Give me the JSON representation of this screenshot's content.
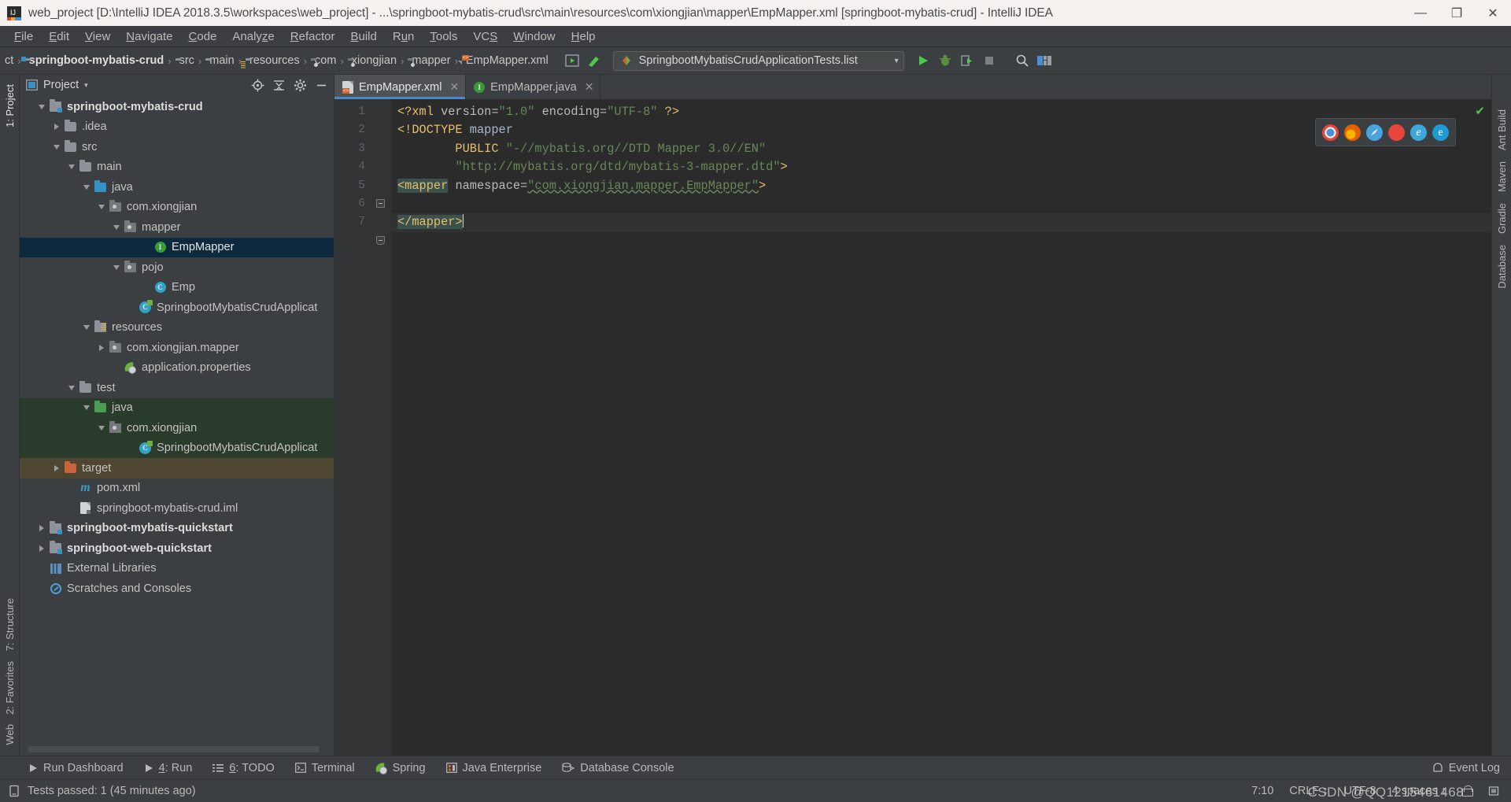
{
  "window": {
    "title": "web_project [D:\\IntelliJ IDEA 2018.3.5\\workspaces\\web_project] - ...\\springboot-mybatis-crud\\src\\main\\resources\\com\\xiongjian\\mapper\\EmpMapper.xml [springboot-mybatis-crud] - IntelliJ IDEA",
    "minimize": "—",
    "maximize": "❐",
    "close": "✕"
  },
  "menu": [
    {
      "label": "File",
      "accel": "F"
    },
    {
      "label": "Edit",
      "accel": "E"
    },
    {
      "label": "View",
      "accel": "V"
    },
    {
      "label": "Navigate",
      "accel": "N"
    },
    {
      "label": "Code",
      "accel": "C"
    },
    {
      "label": "Analyze",
      "accel": "z"
    },
    {
      "label": "Refactor",
      "accel": "R"
    },
    {
      "label": "Build",
      "accel": "B"
    },
    {
      "label": "Run",
      "accel": "u"
    },
    {
      "label": "Tools",
      "accel": "T"
    },
    {
      "label": "VCS",
      "accel": "S"
    },
    {
      "label": "Window",
      "accel": "W"
    },
    {
      "label": "Help",
      "accel": "H"
    }
  ],
  "breadcrumb": {
    "truncated": "ct",
    "items": [
      {
        "label": "springboot-mybatis-crud",
        "icon": "module-icon",
        "bold": true
      },
      {
        "label": "src",
        "icon": "folder-icon",
        "bold": false
      },
      {
        "label": "main",
        "icon": "folder-icon",
        "bold": false
      },
      {
        "label": "resources",
        "icon": "resources-folder-icon",
        "bold": false
      },
      {
        "label": "com",
        "icon": "package-icon",
        "bold": false
      },
      {
        "label": "xiongjian",
        "icon": "package-icon",
        "bold": false
      },
      {
        "label": "mapper",
        "icon": "package-icon",
        "bold": false
      },
      {
        "label": "EmpMapper.xml",
        "icon": "xml-file-icon",
        "bold": false
      }
    ],
    "separator": "›"
  },
  "toolbar": {
    "run_config": "SpringbootMybatisCrudApplicationTests.list",
    "dropdown_arrow": "▾",
    "run_icon": "run-icon",
    "debug_icon": "debug-icon",
    "coverage_icon": "run-with-coverage-icon",
    "stop_icon": "stop-icon",
    "search_icon": "search-everywhere-icon",
    "layout_icon": "layout-icon",
    "build_icon": "build-project-icon",
    "preview_icon": "preview-icon",
    "accent": "#4a88c7"
  },
  "project_panel": {
    "title": "Project",
    "caret": "▾",
    "actions": [
      "locate-icon",
      "collapse-all-icon",
      "settings-icon",
      "hide-icon"
    ],
    "tree": [
      {
        "label": "springboot-mybatis-crud",
        "indent": 1,
        "twisty": "down",
        "icon": "module-icon",
        "bold": true,
        "state": "normal"
      },
      {
        "label": ".idea",
        "indent": 2,
        "twisty": "right",
        "icon": "folder-icon",
        "bold": false,
        "state": "normal"
      },
      {
        "label": "src",
        "indent": 2,
        "twisty": "down",
        "icon": "folder-icon",
        "bold": false,
        "state": "normal"
      },
      {
        "label": "main",
        "indent": 3,
        "twisty": "down",
        "icon": "folder-icon",
        "bold": false,
        "state": "normal"
      },
      {
        "label": "java",
        "indent": 4,
        "twisty": "down",
        "icon": "source-folder-icon",
        "bold": false,
        "state": "normal"
      },
      {
        "label": "com.xiongjian",
        "indent": 5,
        "twisty": "down",
        "icon": "package-icon",
        "bold": false,
        "state": "normal"
      },
      {
        "label": "mapper",
        "indent": 6,
        "twisty": "down",
        "icon": "package-icon",
        "bold": false,
        "state": "normal"
      },
      {
        "label": "EmpMapper",
        "indent": 8,
        "twisty": "none",
        "icon": "interface-icon",
        "bold": false,
        "state": "selected"
      },
      {
        "label": "pojo",
        "indent": 6,
        "twisty": "down",
        "icon": "package-icon",
        "bold": false,
        "state": "normal"
      },
      {
        "label": "Emp",
        "indent": 8,
        "twisty": "none",
        "icon": "class-icon",
        "bold": false,
        "state": "normal"
      },
      {
        "label": "SpringbootMybatisCrudApplicat",
        "indent": 7,
        "twisty": "none",
        "icon": "spring-class-icon",
        "bold": false,
        "state": "normal"
      },
      {
        "label": "resources",
        "indent": 4,
        "twisty": "down",
        "icon": "resources-folder-icon",
        "bold": false,
        "state": "normal"
      },
      {
        "label": "com.xiongjian.mapper",
        "indent": 5,
        "twisty": "right",
        "icon": "package-icon",
        "bold": false,
        "state": "normal"
      },
      {
        "label": "application.properties",
        "indent": 6,
        "twisty": "none",
        "icon": "spring-properties-icon",
        "bold": false,
        "state": "normal"
      },
      {
        "label": "test",
        "indent": 3,
        "twisty": "down",
        "icon": "folder-icon",
        "bold": false,
        "state": "normal"
      },
      {
        "label": "java",
        "indent": 4,
        "twisty": "down",
        "icon": "test-source-folder-icon",
        "bold": false,
        "state": "green"
      },
      {
        "label": "com.xiongjian",
        "indent": 5,
        "twisty": "down",
        "icon": "package-icon",
        "bold": false,
        "state": "green"
      },
      {
        "label": "SpringbootMybatisCrudApplicat",
        "indent": 7,
        "twisty": "none",
        "icon": "spring-test-class-icon",
        "bold": false,
        "state": "green"
      },
      {
        "label": "target",
        "indent": 2,
        "twisty": "right",
        "icon": "excluded-folder-icon",
        "bold": false,
        "state": "brown"
      },
      {
        "label": "pom.xml",
        "indent": 3,
        "twisty": "none",
        "icon": "maven-icon",
        "bold": false,
        "state": "normal"
      },
      {
        "label": "springboot-mybatis-crud.iml",
        "indent": 3,
        "twisty": "none",
        "icon": "iml-file-icon",
        "bold": false,
        "state": "normal"
      },
      {
        "label": "springboot-mybatis-quickstart",
        "indent": 1,
        "twisty": "right",
        "icon": "module-icon",
        "bold": true,
        "state": "normal"
      },
      {
        "label": "springboot-web-quickstart",
        "indent": 1,
        "twisty": "right",
        "icon": "module-icon",
        "bold": true,
        "state": "normal"
      },
      {
        "label": "External Libraries",
        "indent": 1,
        "twisty": "none",
        "icon": "external-libraries-icon",
        "bold": false,
        "state": "normal"
      },
      {
        "label": "Scratches and Consoles",
        "indent": 1,
        "twisty": "none",
        "icon": "scratches-icon",
        "bold": false,
        "state": "normal"
      }
    ]
  },
  "left_rail": [
    {
      "label": "1: Project",
      "active": true
    },
    {
      "label": "7: Structure",
      "active": false
    },
    {
      "label": "2: Favorites",
      "active": false
    },
    {
      "label": "Web",
      "active": false
    }
  ],
  "right_rail": [
    {
      "label": "Ant Build"
    },
    {
      "label": "Maven"
    },
    {
      "label": "Gradle"
    },
    {
      "label": "Database"
    }
  ],
  "editor": {
    "tabs": [
      {
        "label": "EmpMapper.xml",
        "icon": "xml-file-icon",
        "active": true,
        "close": "✕"
      },
      {
        "label": "EmpMapper.java",
        "icon": "interface-icon",
        "active": false,
        "close": "✕"
      }
    ],
    "line_numbers": [
      "1",
      "2",
      "3",
      "4",
      "5",
      "6",
      "7"
    ],
    "lines": [
      {
        "n": 1,
        "segments": [
          {
            "t": "<?xml ",
            "c": "tag"
          },
          {
            "t": "version=",
            "c": "attr"
          },
          {
            "t": "\"1.0\"",
            "c": "str"
          },
          {
            "t": " encoding=",
            "c": "attr"
          },
          {
            "t": "\"UTF-8\"",
            "c": "str"
          },
          {
            "t": " ?>",
            "c": "tag"
          }
        ]
      },
      {
        "n": 2,
        "segments": [
          {
            "t": "<!DOCTYPE ",
            "c": "tag"
          },
          {
            "t": "mapper",
            "c": "plain"
          }
        ]
      },
      {
        "n": 3,
        "segments": [
          {
            "t": "        PUBLIC ",
            "c": "tag"
          },
          {
            "t": "\"-//mybatis.org//DTD Mapper 3.0//EN\"",
            "c": "str"
          }
        ]
      },
      {
        "n": 4,
        "segments": [
          {
            "t": "        ",
            "c": "plain"
          },
          {
            "t": "\"http://mybatis.org/dtd/mybatis-3-mapper.dtd\"",
            "c": "str"
          },
          {
            "t": ">",
            "c": "tag"
          }
        ]
      },
      {
        "n": 5,
        "segments": [
          {
            "t": "<mapper",
            "c": "hl"
          },
          {
            "t": " namespace=",
            "c": "attr"
          },
          {
            "t": "\"com.xiongjian.mapper.EmpMapper\"",
            "c": "str-wavy"
          },
          {
            "t": ">",
            "c": "tag"
          }
        ]
      },
      {
        "n": 6,
        "segments": []
      },
      {
        "n": 7,
        "segments": [
          {
            "t": "</mapper>",
            "c": "hl"
          }
        ]
      }
    ],
    "browser_icons": [
      "chrome-icon",
      "firefox-icon",
      "safari-icon",
      "opera-icon",
      "ie-icon",
      "edge-icon"
    ],
    "inspection_status": "✔"
  },
  "bottom_bar": [
    {
      "label": "Run Dashboard",
      "icon": "play-icon"
    },
    {
      "label": "4: Run",
      "icon": "play-icon",
      "accel": "4"
    },
    {
      "label": "6: TODO",
      "icon": "todo-list-icon",
      "accel": "6"
    },
    {
      "label": "Terminal",
      "icon": "terminal-icon"
    },
    {
      "label": "Spring",
      "icon": "spring-leaf-icon"
    },
    {
      "label": "Java Enterprise",
      "icon": "java-enterprise-icon"
    },
    {
      "label": "Database Console",
      "icon": "database-console-icon"
    }
  ],
  "bottom_right": {
    "label": "Event Log",
    "icon": "event-log-icon"
  },
  "status_bar": {
    "message": "Tests passed: 1 (45 minutes ago)",
    "message_icon": "tests-icon",
    "caret_position": "7:10",
    "line_separator": "CRLF",
    "line_separator_arrow": "↕",
    "encoding": "UTF-8",
    "indent": "4 spaces",
    "indent_arrow": "↕",
    "lock_icon": "read-only-lock-icon",
    "memory_icon": "memory-indicator-icon"
  },
  "watermark": "CSDN @QQ1215461468"
}
